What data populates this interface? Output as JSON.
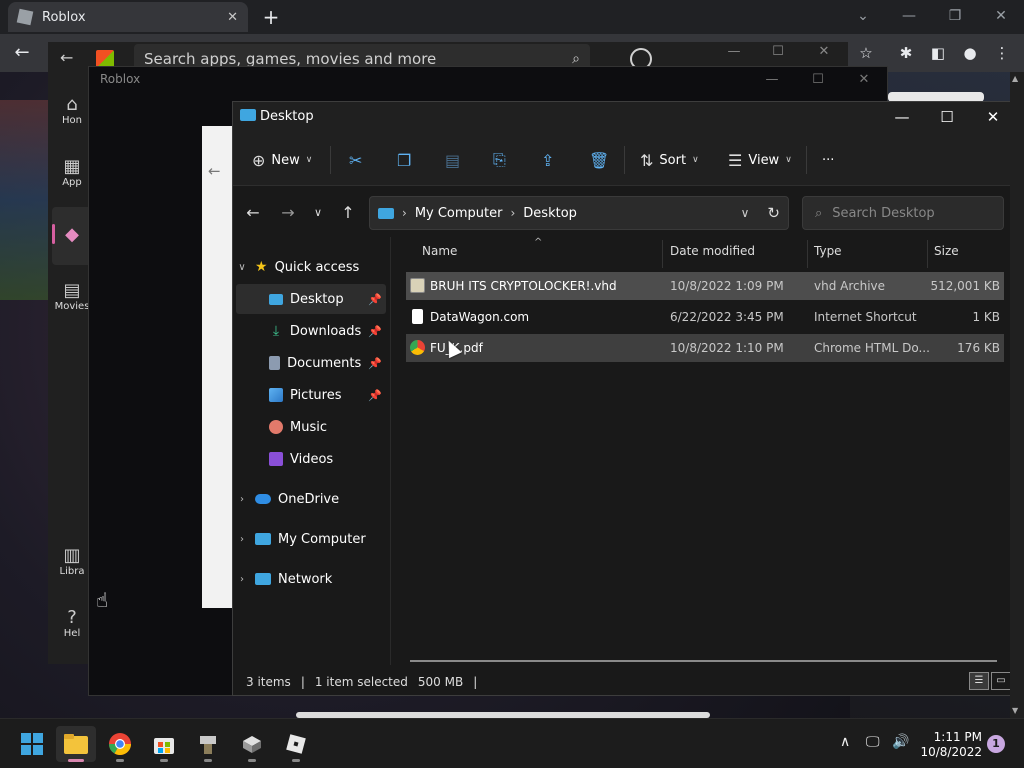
{
  "browser": {
    "tab_title": "Roblox",
    "tab_close": "✕",
    "new_tab": "+",
    "minimize": "—",
    "restore": "❐",
    "close": "✕",
    "back": "←",
    "star": "☆",
    "extensions": "✱",
    "sidebar": "◧",
    "profile": "●",
    "menu": "⋮"
  },
  "store": {
    "search_placeholder": "Search apps, games, movies and more",
    "nav": [
      {
        "icon": "⌂",
        "label": "Hon"
      },
      {
        "icon": "▦",
        "label": "App"
      },
      {
        "icon": "◆",
        "label": ""
      },
      {
        "icon": "▤",
        "label": "Movies"
      },
      {
        "icon": "▥",
        "label": "Libra"
      },
      {
        "icon": "?",
        "label": "Hel"
      }
    ]
  },
  "roblox": {
    "title": "Roblox"
  },
  "explorer": {
    "title": "Desktop",
    "controls": {
      "minimize": "—",
      "maximize": "☐",
      "close": "✕"
    },
    "commands": {
      "new": "New",
      "sort": "Sort",
      "view": "View",
      "more": "···"
    },
    "breadcrumb": [
      "My Computer",
      "Desktop"
    ],
    "search_placeholder": "Search Desktop",
    "sidebar": [
      {
        "label": "Quick access",
        "expander": "∨",
        "pinned": false,
        "active": false
      },
      {
        "label": "Desktop",
        "expander": "",
        "pinned": true,
        "active": true
      },
      {
        "label": "Downloads",
        "expander": "",
        "pinned": true,
        "active": false
      },
      {
        "label": "Documents",
        "expander": "",
        "pinned": true,
        "active": false
      },
      {
        "label": "Pictures",
        "expander": "",
        "pinned": true,
        "active": false
      },
      {
        "label": "Music",
        "expander": "",
        "pinned": false,
        "active": false
      },
      {
        "label": "Videos",
        "expander": "",
        "pinned": false,
        "active": false
      },
      {
        "label": "OneDrive",
        "expander": "›",
        "pinned": false,
        "active": false
      },
      {
        "label": "My Computer",
        "expander": "›",
        "pinned": false,
        "active": false
      },
      {
        "label": "Network",
        "expander": "›",
        "pinned": false,
        "active": false
      }
    ],
    "columns": [
      "Name",
      "Date modified",
      "Type",
      "Size"
    ],
    "files": [
      {
        "name": "BRUH ITS CRYPTOLOCKER!.vhd",
        "date": "10/8/2022 1:09 PM",
        "type": "vhd Archive",
        "size": "512,001 KB",
        "icon": "vhd-file-icon",
        "state": "selected"
      },
      {
        "name": "DataWagon.com",
        "date": "6/22/2022 3:45 PM",
        "type": "Internet Shortcut",
        "size": "1 KB",
        "icon": "url-shortcut-icon",
        "state": "none"
      },
      {
        "name": "FU_K.pdf",
        "date": "10/8/2022 1:10 PM",
        "type": "Chrome HTML Do...",
        "size": "176 KB",
        "icon": "chrome-pdf-icon",
        "state": "hover"
      }
    ],
    "status": {
      "items": "3 items",
      "selected": "1 item selected",
      "size": "500 MB"
    }
  },
  "taskbar": {
    "time": "1:11 PM",
    "date": "10/8/2022",
    "notifications": "1"
  },
  "colors": {
    "accent": "#3fa6e0",
    "explorer_bg": "#191919",
    "selection": "#4d4d4d",
    "taskbar": "#1c1c1c"
  }
}
